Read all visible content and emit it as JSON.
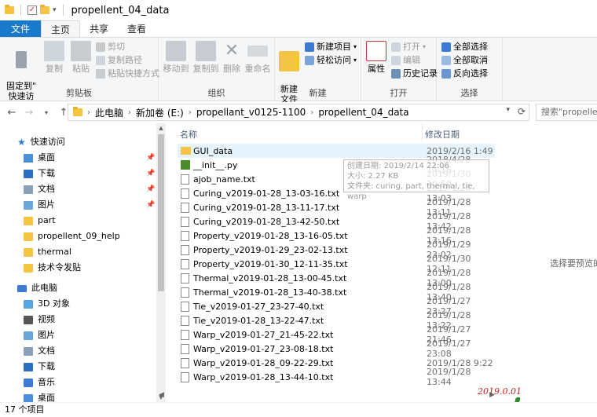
{
  "window": {
    "title": "propellent_04_data"
  },
  "ribbon_tabs": [
    "文件",
    "主页",
    "共享",
    "查看"
  ],
  "ribbon": {
    "clipboard": {
      "pin": "固定到\"\n快速访问\"",
      "copy": "复制",
      "paste": "粘贴",
      "cut": "剪切",
      "copy_path": "复制路径",
      "paste_shortcut": "粘贴快捷方式",
      "label": "剪贴板"
    },
    "organize": {
      "move_to": "移动到",
      "copy_to": "复制到",
      "delete": "删除",
      "rename": "重命名",
      "label": "组织"
    },
    "new": {
      "new_folder": "新建\n文件夹",
      "new_item": "新建项目",
      "easy_access": "轻松访问",
      "label": "新建"
    },
    "open": {
      "properties": "属性",
      "open": "打开",
      "edit": "编辑",
      "history": "历史记录",
      "label": "打开"
    },
    "select": {
      "select_all": "全部选择",
      "select_none": "全部取消",
      "invert": "反向选择",
      "label": "选择"
    }
  },
  "address": {
    "crumbs": [
      "此电脑",
      "新加卷 (E:)",
      "propellant_v0125-1100",
      "propellent_04_data"
    ],
    "search_placeholder": "搜索\"propellen"
  },
  "nav": {
    "quick_access": "快速访问",
    "quick_items": [
      "桌面",
      "下载",
      "文档",
      "图片",
      "part",
      "propellent_09_help",
      "thermal",
      "技术令发贴"
    ],
    "this_pc": "此电脑",
    "pc_items": [
      "3D 对象",
      "视频",
      "图片",
      "文档",
      "下载",
      "音乐",
      "桌面"
    ]
  },
  "columns": {
    "name": "名称",
    "modified": "修改日期"
  },
  "files": [
    {
      "name": "GUI_data",
      "date": "2019/2/16 1:49",
      "type": "folder"
    },
    {
      "name": "__init__.py",
      "date": "2018/4/28 14:16",
      "type": "py"
    },
    {
      "name": "ajob_name.txt",
      "date": "2019/1/30 10:50",
      "type": "txt"
    },
    {
      "name": "Curing_v2019-01-28_13-03-16.txt",
      "date": "2019/1/28 13:03",
      "type": "txt"
    },
    {
      "name": "Curing_v2019-01-28_13-11-17.txt",
      "date": "2019/1/28 13:11",
      "type": "txt"
    },
    {
      "name": "Curing_v2019-01-28_13-42-50.txt",
      "date": "2019/1/28 13:42",
      "type": "txt"
    },
    {
      "name": "Property_v2019-01-28_13-16-05.txt",
      "date": "2019/1/28 13:16",
      "type": "txt"
    },
    {
      "name": "Property_v2019-01-29_23-02-13.txt",
      "date": "2019/1/29 23:02",
      "type": "txt"
    },
    {
      "name": "Property_v2019-01-30_12-11-35.txt",
      "date": "2019/1/30 12:11",
      "type": "txt"
    },
    {
      "name": "Thermal_v2019-01-28_13-00-45.txt",
      "date": "2019/1/28 13:00",
      "type": "txt"
    },
    {
      "name": "Thermal_v2019-01-28_13-40-38.txt",
      "date": "2019/1/28 13:40",
      "type": "txt"
    },
    {
      "name": "Tie_v2019-01-27_23-27-40.txt",
      "date": "2019/1/27 23:27",
      "type": "txt"
    },
    {
      "name": "Tie_v2019-01-28_13-22-47.txt",
      "date": "2019/1/28 13:22",
      "type": "txt"
    },
    {
      "name": "Warp_v2019-01-27_21-45-22.txt",
      "date": "2019/1/27 21:46",
      "type": "txt"
    },
    {
      "name": "Warp_v2019-01-27_23-08-18.txt",
      "date": "2019/1/27 23:08",
      "type": "txt"
    },
    {
      "name": "Warp_v2019-01-28_09-22-29.txt",
      "date": "2019/1/28 9:22",
      "type": "txt"
    },
    {
      "name": "Warp_v2019-01-28_13-44-10.txt",
      "date": "2019/1/28 13:44",
      "type": "txt"
    }
  ],
  "tooltip": [
    "创建日期: 2019/2/14 22:06",
    "大小: 2.27 KB",
    "文件夹: curing, part, thermal, tie, warp"
  ],
  "preview_text": "选择要预览的",
  "status": "17 个项目",
  "stamp": "2019.0.01",
  "colors": {
    "file_tab": "#1979ca",
    "folder": "#f5c542",
    "selection": "#e5f3ff"
  }
}
